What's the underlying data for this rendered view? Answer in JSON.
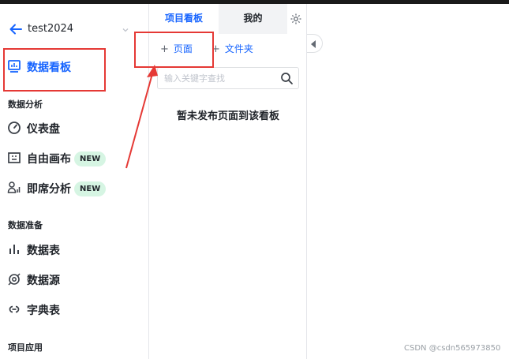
{
  "project": {
    "name": "test2024"
  },
  "sidebar": {
    "items_top": [
      {
        "label": "数据看板",
        "icon": "dashboard-board-icon",
        "active": true
      }
    ],
    "sections": [
      {
        "title": "数据分析",
        "items": [
          {
            "label": "仪表盘",
            "icon": "gauge-icon"
          },
          {
            "label": "自由画布",
            "icon": "canvas-icon",
            "badge": "NEW"
          },
          {
            "label": "即席分析",
            "icon": "adhoc-analysis-icon",
            "badge": "NEW"
          }
        ]
      },
      {
        "title": "数据准备",
        "items": [
          {
            "label": "数据表",
            "icon": "bar-chart-icon"
          },
          {
            "label": "数据源",
            "icon": "data-source-icon"
          },
          {
            "label": "字典表",
            "icon": "dictionary-icon"
          }
        ]
      },
      {
        "title": "项目应用",
        "items": []
      }
    ]
  },
  "panel": {
    "tabs": [
      {
        "label": "项目看板"
      },
      {
        "label": "我的"
      }
    ],
    "add_page": "页面",
    "add_folder": "文件夹",
    "search_placeholder": "输入关键字查找",
    "empty": "暂未发布页面到该看板"
  },
  "watermark": "CSDN @csdn565973850",
  "colors": {
    "accent": "#1664ff",
    "annotation": "#e53935",
    "badge_bg": "#d6f5e3"
  }
}
